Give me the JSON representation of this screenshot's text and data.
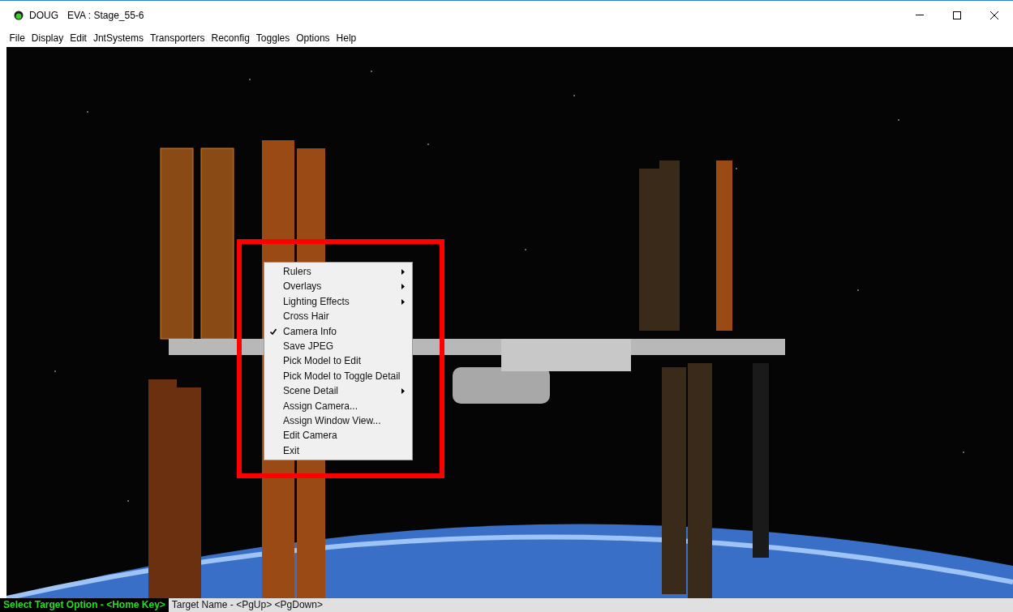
{
  "window": {
    "app_name": "DOUG",
    "title": "EVA : Stage_55-6"
  },
  "menu_bar": [
    "File",
    "Display",
    "Edit",
    "JntSystems",
    "Transporters",
    "Reconfig",
    "Toggles",
    "Options",
    "Help"
  ],
  "context_menu": {
    "highlighted": true,
    "items": [
      {
        "label": "Rulers",
        "checked": false,
        "submenu": true
      },
      {
        "label": "Overlays",
        "checked": false,
        "submenu": true
      },
      {
        "label": "Lighting Effects",
        "checked": false,
        "submenu": true
      },
      {
        "label": "Cross Hair",
        "checked": false,
        "submenu": false
      },
      {
        "label": "Camera Info",
        "checked": true,
        "submenu": false
      },
      {
        "label": "Save JPEG",
        "checked": false,
        "submenu": false
      },
      {
        "label": "Pick Model to Edit",
        "checked": false,
        "submenu": false
      },
      {
        "label": "Pick Model to Toggle Detail",
        "checked": false,
        "submenu": false
      },
      {
        "label": "Scene Detail",
        "checked": false,
        "submenu": true
      },
      {
        "label": "Assign Camera...",
        "checked": false,
        "submenu": false
      },
      {
        "label": "Assign Window View...",
        "checked": false,
        "submenu": false
      },
      {
        "label": "Edit Camera",
        "checked": false,
        "submenu": false
      },
      {
        "label": "Exit",
        "checked": false,
        "submenu": false
      }
    ]
  },
  "status_bar": [
    {
      "text": "Select Target Option - <Home Key>",
      "selected": true
    },
    {
      "text": "Target Name - <PgUp> <PgDown>",
      "selected": false
    }
  ]
}
